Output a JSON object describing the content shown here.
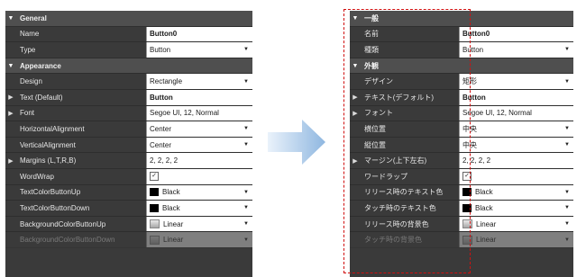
{
  "left_panel": {
    "rows": [
      {
        "kind": "group",
        "label": "General"
      },
      {
        "kind": "prop",
        "name": "Name",
        "value": "Button0",
        "bold": true
      },
      {
        "kind": "prop",
        "name": "Type",
        "value": "Button",
        "dropdown": true
      },
      {
        "kind": "group",
        "label": "Appearance"
      },
      {
        "kind": "prop",
        "name": "Design",
        "value": "Rectangle",
        "dropdown": true
      },
      {
        "kind": "prop",
        "name": "Text (Default)",
        "value": "Button",
        "bold": true,
        "expandable": true
      },
      {
        "kind": "prop",
        "name": "Font",
        "value": "Segoe UI, 12, Normal",
        "expandable": true
      },
      {
        "kind": "prop",
        "name": "HorizontalAlignment",
        "value": "Center",
        "dropdown": true
      },
      {
        "kind": "prop",
        "name": "VerticalAlignment",
        "value": "Center",
        "dropdown": true
      },
      {
        "kind": "prop",
        "name": "Margins (L,T,R,B)",
        "value": "2, 2, 2, 2",
        "expandable": true
      },
      {
        "kind": "prop",
        "name": "WordWrap",
        "value": "✓",
        "checkbox": true
      },
      {
        "kind": "prop",
        "name": "TextColorButtonUp",
        "value": "Black",
        "swatch": "black",
        "dropdown": true
      },
      {
        "kind": "prop",
        "name": "TextColorButtonDown",
        "value": "Black",
        "swatch": "black",
        "dropdown": true
      },
      {
        "kind": "prop",
        "name": "BackgroundColorButtonUp",
        "value": "Linear",
        "swatch": "linear",
        "dropdown": true
      },
      {
        "kind": "prop",
        "name": "BackgroundColorButtonDown",
        "value": "Linear",
        "swatch": "linear",
        "dropdown": true,
        "faded": true
      }
    ]
  },
  "right_panel": {
    "rows": [
      {
        "kind": "group",
        "label": "一般"
      },
      {
        "kind": "prop",
        "name": "名前",
        "value": "Button0",
        "bold": true
      },
      {
        "kind": "prop",
        "name": "種類",
        "value": "Button",
        "dropdown": true
      },
      {
        "kind": "group",
        "label": "外観"
      },
      {
        "kind": "prop",
        "name": "デザイン",
        "value": "矩形",
        "dropdown": true
      },
      {
        "kind": "prop",
        "name": "テキスト(デフォルト)",
        "value": "Button",
        "bold": true,
        "expandable": true
      },
      {
        "kind": "prop",
        "name": "フォント",
        "value": "Segoe UI, 12, Normal",
        "expandable": true
      },
      {
        "kind": "prop",
        "name": "横位置",
        "value": "中央",
        "dropdown": true
      },
      {
        "kind": "prop",
        "name": "縦位置",
        "value": "中央",
        "dropdown": true
      },
      {
        "kind": "prop",
        "name": "マージン(上下左右)",
        "value": "2, 2, 2, 2",
        "expandable": true
      },
      {
        "kind": "prop",
        "name": "ワードラップ",
        "value": "✓",
        "checkbox": true
      },
      {
        "kind": "prop",
        "name": "リリース時のテキスト色",
        "value": "Black",
        "swatch": "black",
        "dropdown": true
      },
      {
        "kind": "prop",
        "name": "タッチ時のテキスト色",
        "value": "Black",
        "swatch": "black",
        "dropdown": true
      },
      {
        "kind": "prop",
        "name": "リリース時の背景色",
        "value": "Linear",
        "swatch": "linear",
        "dropdown": true
      },
      {
        "kind": "prop",
        "name": "タッチ時の背景色",
        "value": "Linear",
        "swatch": "linear",
        "dropdown": true,
        "faded": true
      }
    ]
  },
  "colors": {
    "panel_bg": "#3a3a3a",
    "group_bg": "#4f4f4f",
    "highlight_border": "#d01010",
    "arrow": "#a9c8e8"
  },
  "icons": {
    "group_caret": "triangle-down-icon",
    "expand_caret": "triangle-right-icon",
    "dropdown": "chevron-down-icon",
    "arrow": "right-arrow-icon"
  }
}
